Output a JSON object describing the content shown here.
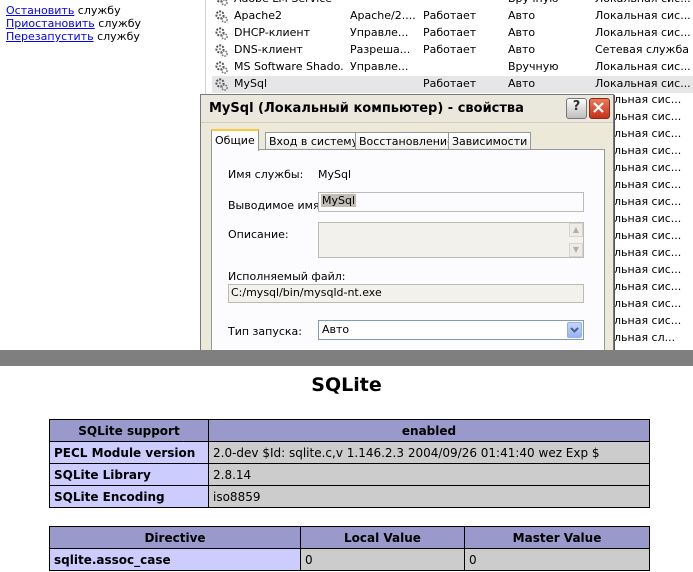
{
  "services_window": {
    "actions": [
      {
        "link": "Остановить",
        "rest": " службу"
      },
      {
        "link": "Приостановить",
        "rest": " службу"
      },
      {
        "link": "Перезапустить",
        "rest": " службу"
      }
    ],
    "rows": [
      {
        "name": "Adobe LM Service",
        "desc": "",
        "status": "",
        "startup": "Вручную",
        "logon": "Локальная сис..."
      },
      {
        "name": "Apache2",
        "desc": "Apache/2....",
        "status": "Работает",
        "startup": "Авто",
        "logon": "Локальная сис..."
      },
      {
        "name": "DHCP-клиент",
        "desc": "Управле...",
        "status": "Работает",
        "startup": "Авто",
        "logon": "Локальная сис..."
      },
      {
        "name": "DNS-клиент",
        "desc": "Разреша...",
        "status": "Работает",
        "startup": "Авто",
        "logon": "Сетевая служба"
      },
      {
        "name": "MS Software Shado...",
        "desc": "Управле...",
        "status": "",
        "startup": "Вручную",
        "logon": "Локальная сис..."
      },
      {
        "name": "MySql",
        "desc": "",
        "status": "Работает",
        "startup": "Авто",
        "logon": "Локальная сис..."
      }
    ],
    "right_column_tail": [
      "льная сис...",
      "льная сис...",
      "льная сис...",
      "льная сис...",
      "льная сис...",
      "льная сис...",
      "льная сис...",
      "льная сис...",
      "льная сис...",
      "льная сис...",
      "льная сис...",
      "льная сис...",
      "льная сис...",
      "льная сис...",
      "льная сл..."
    ]
  },
  "dialog": {
    "title": "MySql (Локальный компьютер) - свойства",
    "help_label": "?",
    "tabs": [
      "Общие",
      "Вход в систему",
      "Восстановление",
      "Зависимости"
    ],
    "service_name_label": "Имя службы:",
    "service_name_value": "MySql",
    "display_name_label": "Выводимое имя:",
    "display_name_value": "MySql",
    "description_label": "Описание:",
    "executable_label": "Исполняемый файл:",
    "executable_value": "C:/mysql/bin/mysqld-nt.exe",
    "startup_type_label": "Тип запуска:",
    "startup_type_value": "Авто"
  },
  "sqlite": {
    "heading": "SQLite",
    "table1": {
      "header": [
        "SQLite support",
        "enabled"
      ],
      "rows": [
        [
          "PECL Module version",
          "2.0-dev $Id: sqlite.c,v 1.146.2.3 2004/09/26 01:41:40 wez Exp $"
        ],
        [
          "SQLite Library",
          "2.8.14"
        ],
        [
          "SQLite Encoding",
          "iso8859"
        ]
      ]
    },
    "table2": {
      "header": [
        "Directive",
        "Local Value",
        "Master Value"
      ],
      "rows": [
        [
          "sqlite.assoc_case",
          "0",
          "0"
        ]
      ]
    }
  }
}
